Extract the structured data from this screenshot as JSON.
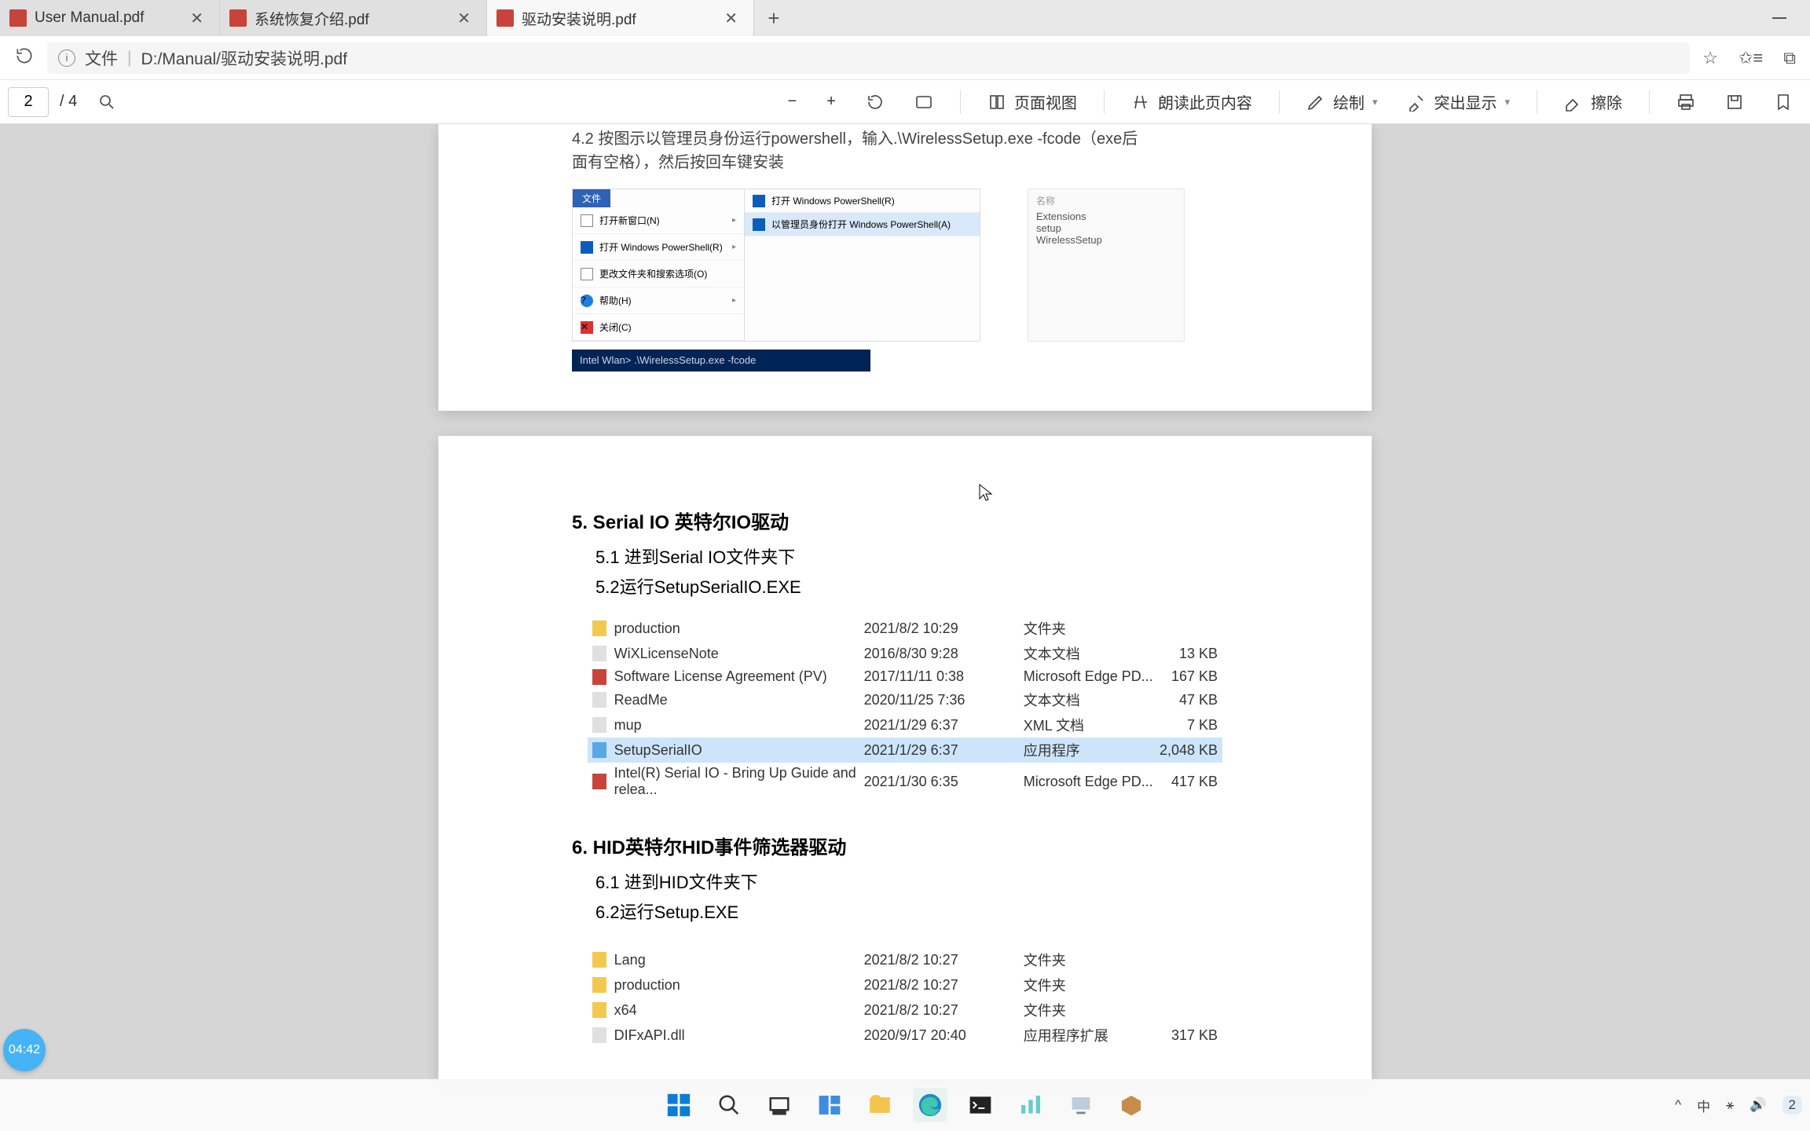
{
  "tabs": [
    {
      "title": "User Manual.pdf",
      "active": false
    },
    {
      "title": "系统恢复介绍.pdf",
      "active": false
    },
    {
      "title": "驱动安装说明.pdf",
      "active": true
    }
  ],
  "newtab": "+",
  "address": {
    "scheme": "文件",
    "path": "D:/Manual/驱动安装说明.pdf"
  },
  "pdf_toolbar": {
    "page_current": "2",
    "page_sep": "/ 4",
    "page_view": "页面视图",
    "read_aloud": "朗读此页内容",
    "draw": "绘制",
    "highlight": "突出显示",
    "erase": "擦除"
  },
  "doc": {
    "line42_a": "4.2 按图示以管理员身份运行powershell，输入.\\WirelessSetup.exe -fcode（exe后",
    "line42_b": "面有空格），然后按回车键安装",
    "ctx": {
      "file_tab": "文件",
      "open_new": "打开新窗口(N)",
      "open_ps": "打开 Windows PowerShell(R)",
      "open_ps_r": "打开 Windows PowerShell(R)",
      "open_ps_admin": "以管理员身份打开 Windows PowerShell(A)",
      "change_opt": "更改文件夹和搜索选项(O)",
      "help": "帮助(H)",
      "close": "关闭(C)",
      "ext_head": "名称",
      "ext1": "Extensions",
      "ext2": "setup",
      "ext3": "WirelessSetup"
    },
    "ps_line": "Intel Wlan> .\\WirelessSetup.exe -fcode",
    "sect5_title": "5.   Serial IO 英特尔IO驱动",
    "sect5_1": "5.1 进到Serial IO文件夹下",
    "sect5_2": "5.2运行SetupSerialIO.EXE",
    "files5": [
      {
        "icon": "folder",
        "name": "production",
        "date": "2021/8/2 10:29",
        "type": "文件夹",
        "size": ""
      },
      {
        "icon": "txt",
        "name": "WiXLicenseNote",
        "date": "2016/8/30 9:28",
        "type": "文本文档",
        "size": "13 KB"
      },
      {
        "icon": "pdf",
        "name": "Software License Agreement (PV)",
        "date": "2017/11/11 0:38",
        "type": "Microsoft Edge PD...",
        "size": "167 KB"
      },
      {
        "icon": "txt",
        "name": "ReadMe",
        "date": "2020/11/25 7:36",
        "type": "文本文档",
        "size": "47 KB"
      },
      {
        "icon": "txt",
        "name": "mup",
        "date": "2021/1/29 6:37",
        "type": "XML 文档",
        "size": "7 KB"
      },
      {
        "icon": "exe",
        "name": "SetupSerialIO",
        "date": "2021/1/29 6:37",
        "type": "应用程序",
        "size": "2,048 KB",
        "sel": true
      },
      {
        "icon": "pdf",
        "name": "Intel(R) Serial IO - Bring Up Guide and relea...",
        "date": "2021/1/30 6:35",
        "type": "Microsoft Edge PD...",
        "size": "417 KB"
      }
    ],
    "sect6_title": "6.   HID英特尔HID事件筛选器驱动",
    "sect6_1": "6.1 进到HID文件夹下",
    "sect6_2": "6.2运行Setup.EXE",
    "files6": [
      {
        "icon": "folder",
        "name": "Lang",
        "date": "2021/8/2 10:27",
        "type": "文件夹",
        "size": ""
      },
      {
        "icon": "folder",
        "name": "production",
        "date": "2021/8/2 10:27",
        "type": "文件夹",
        "size": ""
      },
      {
        "icon": "folder",
        "name": "x64",
        "date": "2021/8/2 10:27",
        "type": "文件夹",
        "size": ""
      },
      {
        "icon": "txt",
        "name": "DIFxAPI.dll",
        "date": "2020/9/17 20:40",
        "type": "应用程序扩展",
        "size": "317 KB"
      }
    ]
  },
  "timestamp": "04:42",
  "tray": {
    "chevron": "^",
    "ime": "中",
    "net": "◈",
    "vol": "🔊",
    "notify": "2"
  }
}
